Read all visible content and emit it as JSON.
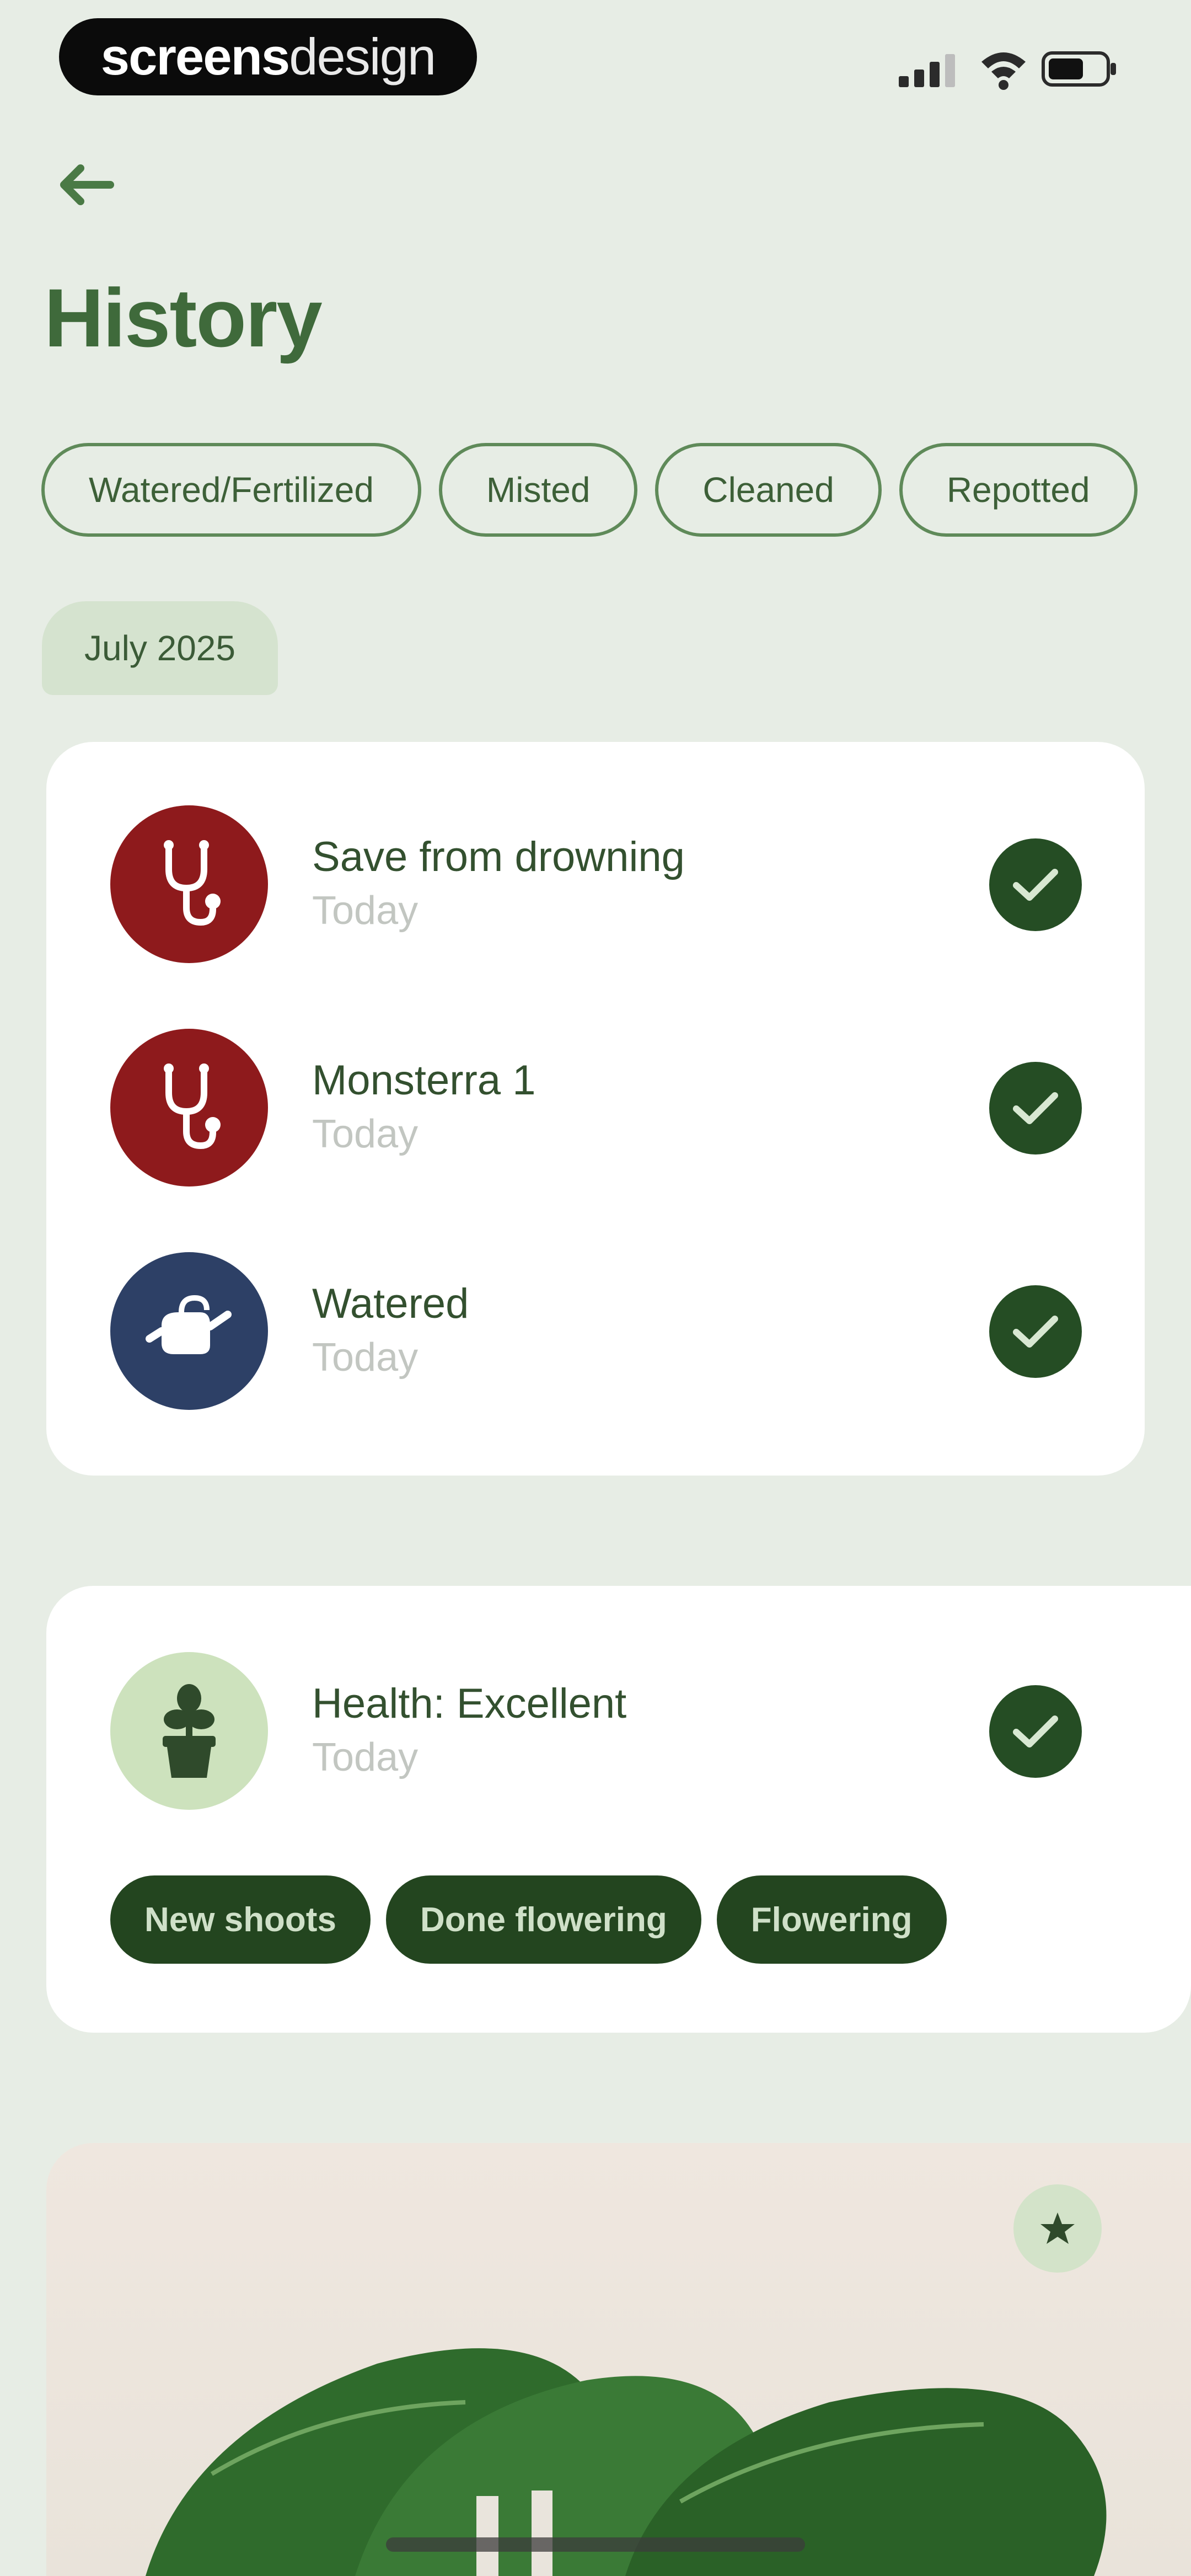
{
  "status_bar": {
    "brand_bold": "screens",
    "brand_light": "design"
  },
  "header": {
    "title": "History"
  },
  "filters": [
    {
      "label": "Watered/Fertilized"
    },
    {
      "label": "Misted"
    },
    {
      "label": "Cleaned"
    },
    {
      "label": "Repotted"
    }
  ],
  "month": "July 2025",
  "activities": [
    {
      "title": "Save from drowning",
      "subtitle": "Today",
      "icon": "stethoscope-icon",
      "color": "#8e1a1c"
    },
    {
      "title": "Monsterra 1",
      "subtitle": "Today",
      "icon": "stethoscope-icon",
      "color": "#8e1a1c"
    },
    {
      "title": "Watered",
      "subtitle": "Today",
      "icon": "watering-can-icon",
      "color": "#2d4066"
    }
  ],
  "health": {
    "title": "Health: Excellent",
    "subtitle": "Today",
    "icon": "potted-plant-icon",
    "color": "#cde2bd",
    "tags": [
      "New shoots",
      "Done flowering",
      "Flowering"
    ]
  },
  "colors": {
    "background": "#e7ede5",
    "accent_dark": "#254d24",
    "title_green": "#3f6a3b"
  }
}
